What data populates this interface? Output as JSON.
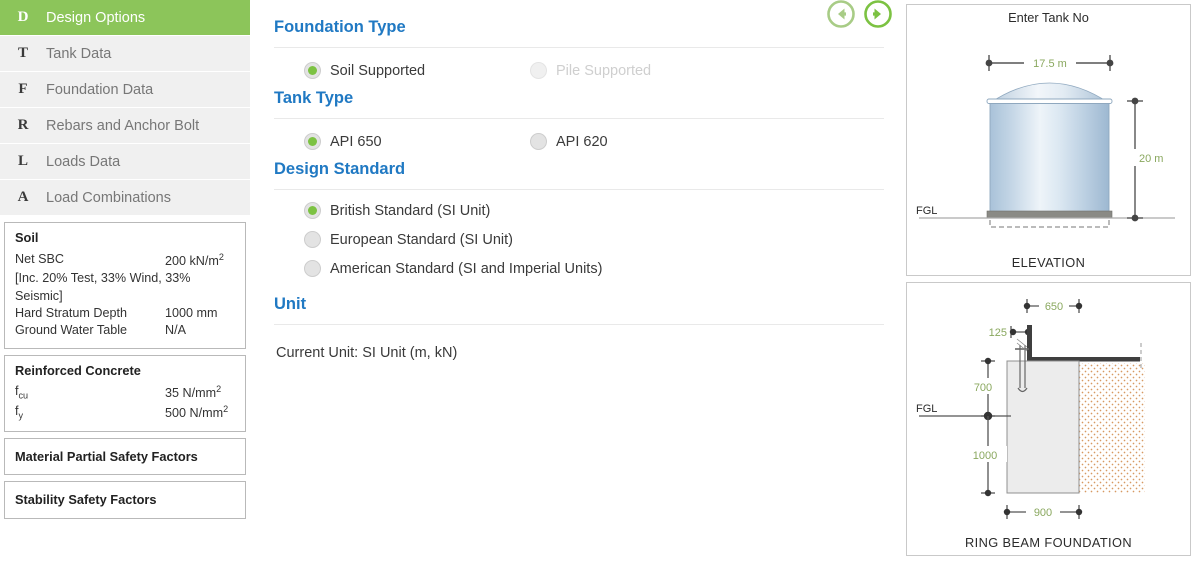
{
  "theme": {
    "accent_green": "#8cc55a",
    "radio_green": "#7cc242",
    "heading_blue": "#2079c3",
    "sidebar_bg": "#f0f0f0",
    "dim_green": "#8aa85f"
  },
  "sidebar": {
    "nav_items": [
      {
        "letter": "D",
        "label": "Design Options",
        "active": true
      },
      {
        "letter": "T",
        "label": "Tank Data",
        "active": false
      },
      {
        "letter": "F",
        "label": "Foundation Data",
        "active": false
      },
      {
        "letter": "R",
        "label": "Rebars and Anchor Bolt",
        "active": false
      },
      {
        "letter": "L",
        "label": "Loads Data",
        "active": false
      },
      {
        "letter": "A",
        "label": "Load Combinations",
        "active": false
      }
    ],
    "soil": {
      "title": "Soil",
      "net_sbc_label": "Net SBC",
      "net_sbc_value": "200 kN/m",
      "net_sbc_unit_sup": "2",
      "note": "[Inc. 20% Test, 33% Wind, 33% Seismic]",
      "hard_stratum_label": "Hard Stratum Depth",
      "hard_stratum_value": "1000 mm",
      "gwt_label": "Ground Water Table",
      "gwt_value": "N/A"
    },
    "concrete": {
      "title": "Reinforced Concrete",
      "fcu_label": "f",
      "fcu_sub": "cu",
      "fcu_value": "35 N/mm",
      "fcu_sup": "2",
      "fy_label": "f",
      "fy_sub": "y",
      "fy_value": "500 N/mm",
      "fy_sup": "2"
    },
    "material_partial_safety_factors": "Material Partial Safety Factors",
    "stability_safety_factors": "Stability Safety Factors"
  },
  "main": {
    "nav": {
      "prev_icon": "arrow-left-circle-icon",
      "next_icon": "arrow-right-circle-icon"
    },
    "sections": [
      {
        "title": "Foundation Type",
        "options": [
          {
            "label": "Soil Supported",
            "checked": true,
            "disabled": false
          },
          {
            "label": "Pile Supported",
            "checked": false,
            "disabled": true
          }
        ],
        "layout": "row"
      },
      {
        "title": "Tank Type",
        "options": [
          {
            "label": "API 650",
            "checked": true,
            "disabled": false
          },
          {
            "label": "API 620",
            "checked": false,
            "disabled": false
          }
        ],
        "layout": "row"
      },
      {
        "title": "Design Standard",
        "options": [
          {
            "label": "British Standard (SI Unit)",
            "checked": true,
            "disabled": false
          },
          {
            "label": "European Standard (SI Unit)",
            "checked": false,
            "disabled": false
          },
          {
            "label": "American Standard (SI and Imperial Units)",
            "checked": false,
            "disabled": false
          }
        ],
        "layout": "stacked"
      }
    ],
    "unit_section_title": "Unit",
    "current_unit": "Current Unit: SI Unit (m, kN)"
  },
  "diagrams": {
    "elevation": {
      "top_label": "Enter Tank No",
      "caption": "ELEVATION",
      "diameter": "17.5 m",
      "height": "20 m",
      "ground_label": "FGL"
    },
    "foundation": {
      "caption": "RING BEAM FOUNDATION",
      "top_width": "650",
      "shell_thickness": "125",
      "upper_depth": "700",
      "lower_depth": "1000",
      "base_width": "900",
      "ground_label": "FGL"
    }
  }
}
